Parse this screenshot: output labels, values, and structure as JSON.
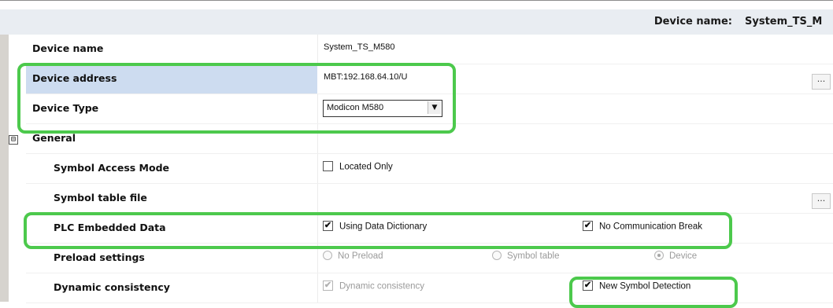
{
  "header": {
    "device_name_label": "Device name:",
    "device_name_value": "System_TS_M"
  },
  "rows": {
    "device_name": {
      "label": "Device name",
      "value": "System_TS_M580"
    },
    "device_address": {
      "label": "Device address",
      "value": "MBT:192.168.64.10/U",
      "browse": "..."
    },
    "device_type": {
      "label": "Device Type",
      "value": "Modicon M580"
    },
    "general": {
      "label": "General",
      "collapse_glyph": "⊟"
    },
    "symbol_access_mode": {
      "label": "Symbol Access Mode",
      "option": "Located Only",
      "checked": false
    },
    "symbol_table_file": {
      "label": "Symbol table file",
      "browse": "..."
    },
    "plc_embedded_data": {
      "label": "PLC Embedded Data",
      "opt1": "Using Data Dictionary",
      "opt1_checked": true,
      "opt2": "No Communication Break",
      "opt2_checked": true
    },
    "preload_settings": {
      "label": "Preload settings",
      "radio1": "No Preload",
      "radio2": "Symbol table",
      "radio3": "Device",
      "selected": "Device"
    },
    "dynamic_consistency": {
      "label": "Dynamic consistency",
      "opt1": "Dynamic consistency",
      "opt1_checked": true,
      "opt2": "New Symbol Detection",
      "opt2_checked": true
    }
  },
  "glyphs": {
    "check": "✔",
    "dropdown": "▼"
  },
  "colors": {
    "highlight": "#4cc94c",
    "selected_row": "#cddcf0",
    "header_bg": "#e9edf2"
  }
}
